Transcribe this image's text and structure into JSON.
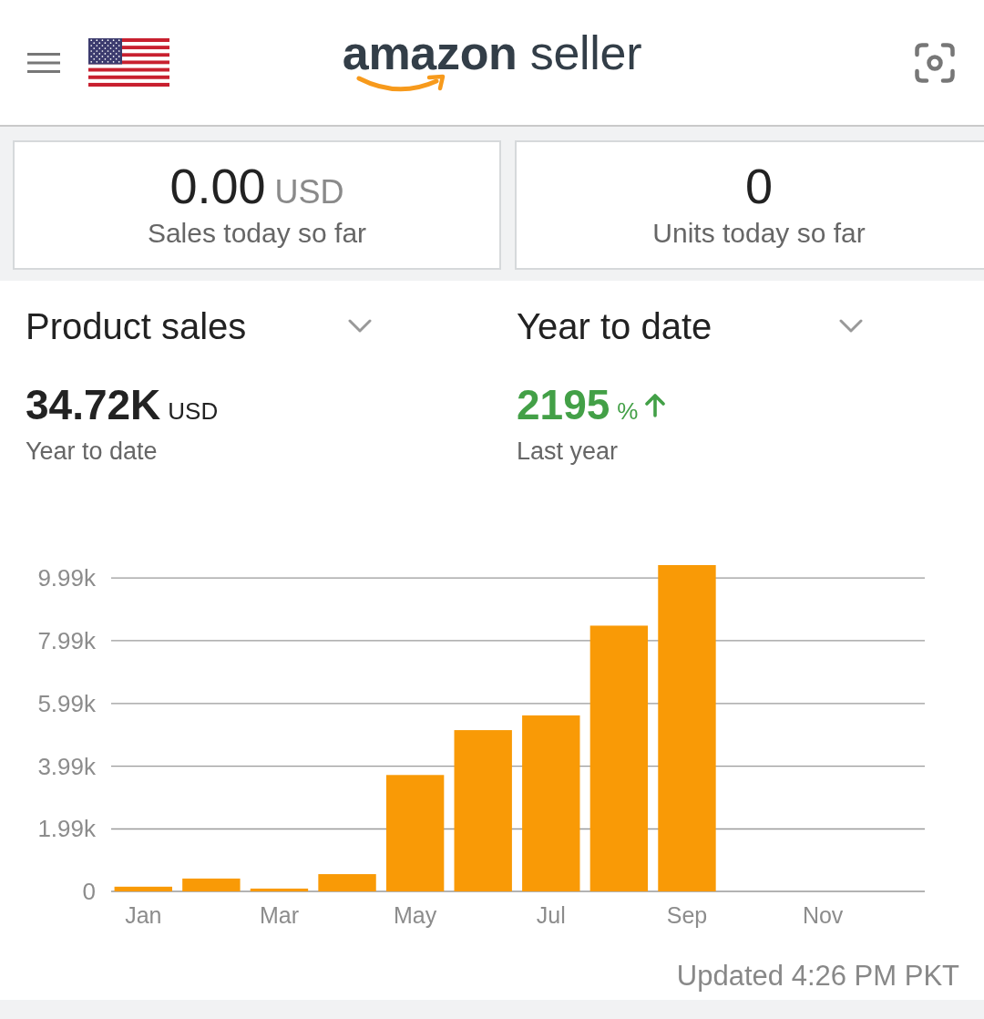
{
  "header": {
    "logo": "**amazon** seller"
  },
  "today_cards": [
    {
      "value": "0.00",
      "unit": "USD",
      "label": "Sales today so far"
    },
    {
      "value": "0",
      "label": "Units today so far"
    }
  ],
  "metric_selectors": [
    {
      "label": "Product sales"
    },
    {
      "label": "Year to date"
    }
  ],
  "summary": [
    {
      "kind": "total",
      "value": "34.72K",
      "unit": "USD",
      "caption": "Year to date"
    },
    {
      "kind": "change",
      "value": "2195",
      "unit": "%",
      "caption": "Last year"
    }
  ],
  "chart": {
    "chart_data": {
      "type": "bar",
      "categories": [
        "Jan",
        null,
        "Mar",
        null,
        "May",
        null,
        "Jul",
        null,
        "Sep",
        null,
        "Nov",
        null
      ],
      "values": [
        150,
        410,
        90,
        550,
        3710,
        5140,
        5610,
        8470,
        10400,
        null,
        null,
        null
      ],
      "ylim": [
        0,
        10400
      ],
      "yticks": [
        {
          "value": 0,
          "label": "0"
        },
        {
          "value": 1990,
          "label": "1.99k"
        },
        {
          "value": 3990,
          "label": "3.99k"
        },
        {
          "value": 5990,
          "label": "5.99k"
        },
        {
          "value": 7990,
          "label": "7.99k"
        },
        {
          "value": 9990,
          "label": "9.99k"
        }
      ],
      "grid": true
    }
  },
  "updated": "Updated 4:26 PM PKT"
}
